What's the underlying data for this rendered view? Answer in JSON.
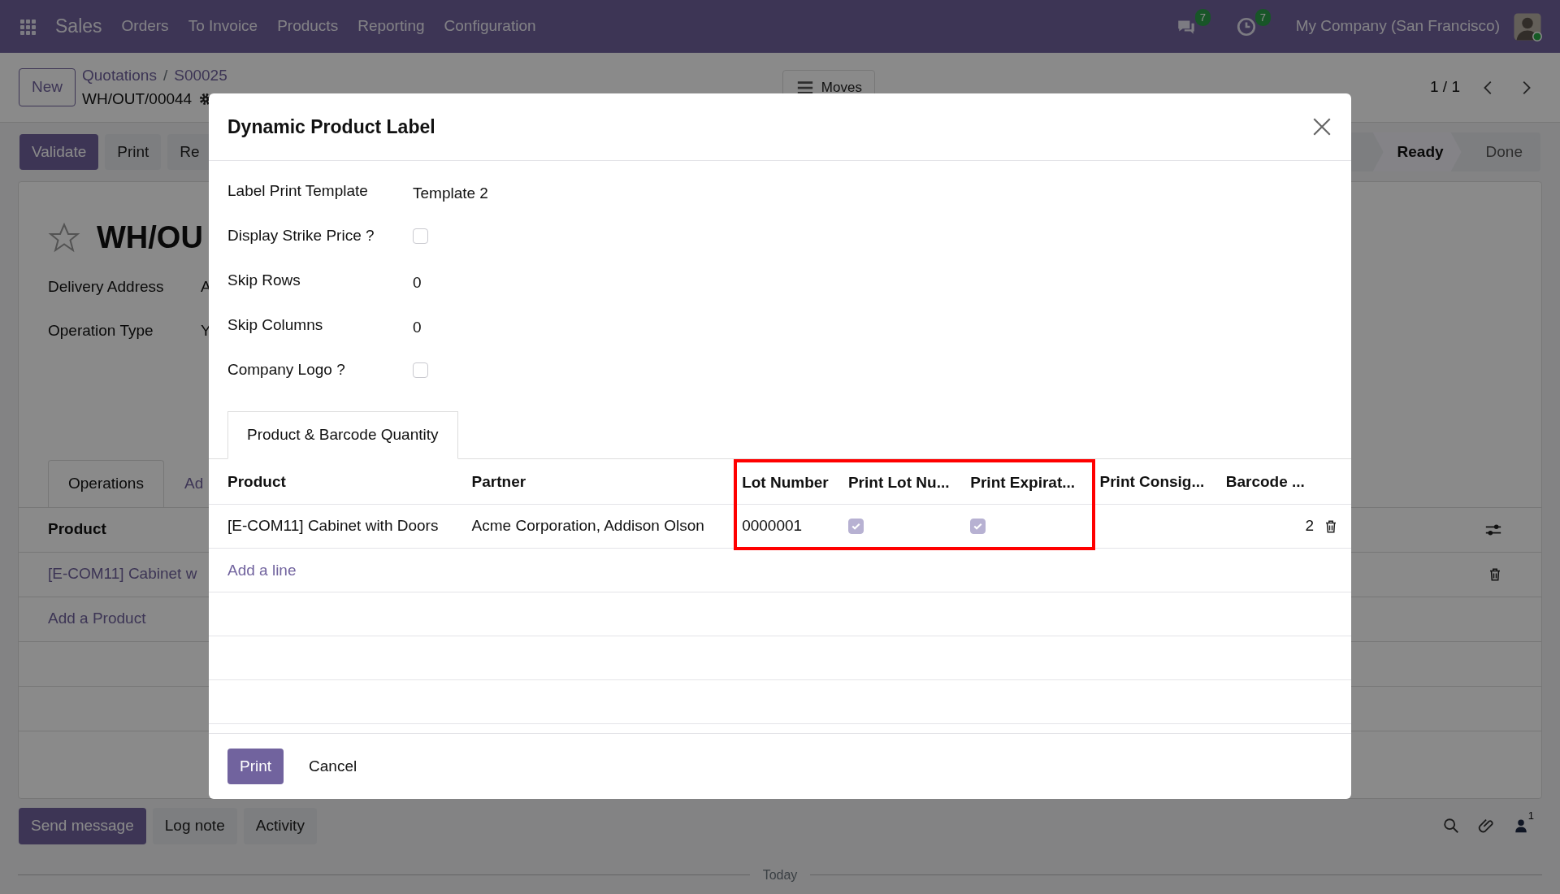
{
  "navbar": {
    "app": "Sales",
    "menu": [
      "Orders",
      "To Invoice",
      "Products",
      "Reporting",
      "Configuration"
    ],
    "messages_badge": "7",
    "activities_badge": "7",
    "company": "My Company (San Francisco)"
  },
  "control_panel": {
    "new_button": "New",
    "breadcrumbs": [
      "Quotations",
      "S00025"
    ],
    "breadcrumb_separator": "/",
    "record": "WH/OUT/00044",
    "moves_button": "Moves",
    "pager": "1 / 1"
  },
  "actions": [
    {
      "label": "Validate",
      "kind": "primary"
    },
    {
      "label": "Print",
      "kind": "secondary"
    },
    {
      "label": "Re",
      "kind": "secondary"
    }
  ],
  "statusbar": [
    {
      "label": "Ready",
      "selected": true
    },
    {
      "label": "Done",
      "selected": false
    }
  ],
  "form": {
    "favorite": false,
    "title": "WH/OU",
    "fields": [
      {
        "label": "Delivery Address",
        "value": "A"
      },
      {
        "label": "Operation Type",
        "value": "Y"
      }
    ],
    "tabs": [
      {
        "label": "Operations",
        "selected": true
      },
      {
        "label": "Ad",
        "selected": false
      }
    ],
    "table": {
      "columns": [
        "Product"
      ],
      "rows": [
        "[E-COM11] Cabinet w"
      ],
      "add_link": "Add a Product"
    }
  },
  "chatter": {
    "buttons": [
      {
        "label": "Send message",
        "kind": "primary"
      },
      {
        "label": "Log note",
        "kind": "secondary"
      },
      {
        "label": "Activity",
        "kind": "secondary"
      }
    ],
    "followers": "1",
    "separator": "Today"
  },
  "dialog": {
    "title": "Dynamic Product Label",
    "fields": [
      {
        "kind": "text",
        "label": "Label Print Template",
        "value": "Template 2"
      },
      {
        "kind": "checkbox",
        "label": "Display Strike Price ?",
        "checked": false
      },
      {
        "kind": "text",
        "label": "Skip Rows",
        "value": "0"
      },
      {
        "kind": "text",
        "label": "Skip Columns",
        "value": "0"
      },
      {
        "kind": "checkbox",
        "label": "Company Logo ?",
        "checked": false
      }
    ],
    "tabs": [
      {
        "label": "Product & Barcode Quantity",
        "selected": true
      }
    ],
    "table": {
      "columns": [
        {
          "label": "Product",
          "highlighted": false
        },
        {
          "label": "Partner",
          "highlighted": false
        },
        {
          "label": "Lot Number",
          "highlighted": true
        },
        {
          "label": "Print Lot Nu...",
          "highlighted": true
        },
        {
          "label": "Print Expirat...",
          "highlighted": true
        },
        {
          "label": "Print Consig...",
          "highlighted": false
        },
        {
          "label": "Barcode ...",
          "highlighted": false
        }
      ],
      "rows": [
        {
          "product": "[E-COM11] Cabinet with Doors",
          "partner": "Acme Corporation, Addison Olson",
          "lot_number": "0000001",
          "print_lot_number": true,
          "print_expiration": true,
          "quantity": "2"
        }
      ],
      "add_line": "Add a line"
    },
    "buttons": [
      {
        "label": "Print",
        "kind": "primary"
      },
      {
        "label": "Cancel",
        "kind": "link"
      }
    ]
  }
}
